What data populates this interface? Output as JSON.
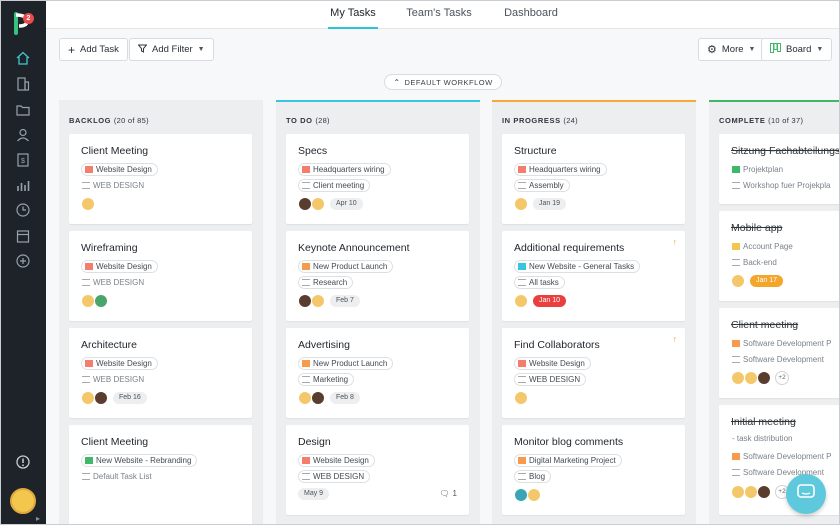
{
  "app": {
    "logo_badge": "2"
  },
  "sidebar": {
    "items": [
      {
        "icon": "home-icon"
      },
      {
        "icon": "building-icon"
      },
      {
        "icon": "folder-icon"
      },
      {
        "icon": "user-icon"
      },
      {
        "icon": "invoice-icon"
      },
      {
        "icon": "chart-icon"
      },
      {
        "icon": "clock-icon"
      },
      {
        "icon": "calendar-icon"
      },
      {
        "icon": "plus-circle-icon"
      }
    ],
    "help_icon": "info-icon"
  },
  "topnav": {
    "tabs": [
      "My Tasks",
      "Team's Tasks",
      "Dashboard"
    ],
    "active": "My Tasks"
  },
  "toolbar": {
    "add_task": "Add Task",
    "add_filter": "Add Filter",
    "more": "More",
    "board": "Board",
    "workflow": "DEFAULT WORKFLOW"
  },
  "colors": {
    "accent": "#2ac4d5",
    "todo": "#37c6e0",
    "in_progress": "#f6a936",
    "complete": "#3fb86a",
    "overdue": "#e9403d"
  },
  "columns": [
    {
      "title": "BACKLOG",
      "count": "(20 of 85)",
      "cards": [
        {
          "title": "Client Meeting",
          "tags": [
            "Website Design",
            "WEB DESIGN"
          ],
          "date": ""
        },
        {
          "title": "Wireframing",
          "tags": [
            "Website Design",
            "WEB DESIGN"
          ],
          "date": ""
        },
        {
          "title": "Architecture",
          "tags": [
            "Website Design",
            "WEB DESIGN"
          ],
          "date": "Feb 16"
        },
        {
          "title": "Client Meeting",
          "tags": [
            "New Website - Rebranding",
            "Default Task List"
          ],
          "date": ""
        }
      ]
    },
    {
      "title": "TO DO",
      "count": "(28)",
      "cards": [
        {
          "title": "Specs",
          "tags": [
            "Headquarters wiring",
            "Client meeting"
          ],
          "date": "Apr 10"
        },
        {
          "title": "Keynote Announcement",
          "tags": [
            "New Product Launch",
            "Research"
          ],
          "date": "Feb 7"
        },
        {
          "title": "Advertising",
          "tags": [
            "New Product Launch",
            "Marketing"
          ],
          "date": "Feb 8"
        },
        {
          "title": "Design",
          "tags": [
            "Website Design",
            "WEB DESIGN"
          ],
          "date": "May 9",
          "comments": "1"
        }
      ]
    },
    {
      "title": "IN PROGRESS",
      "count": "(24)",
      "cards": [
        {
          "title": "Structure",
          "tags": [
            "Headquarters wiring",
            "Assembly"
          ],
          "date": "Jan 19"
        },
        {
          "title": "Additional requirements",
          "tags": [
            "New Website - General Tasks",
            "All tasks"
          ],
          "date": "Jan 10"
        },
        {
          "title": "Find Collaborators",
          "tags": [
            "Website Design",
            "WEB DESIGN"
          ],
          "date": ""
        },
        {
          "title": "Monitor blog comments",
          "tags": [
            "Digital Marketing Project",
            "Blog"
          ],
          "date": ""
        }
      ]
    },
    {
      "title": "COMPLETE",
      "count": "(10 of 37)",
      "cards": [
        {
          "title": "Sitzung Fachabteilungsl",
          "tags": [
            "Projektplan",
            "Workshop fuer Projekpla"
          ],
          "date": ""
        },
        {
          "title": "Mobile app",
          "tags": [
            "Account Page",
            "Back-end"
          ],
          "date": "Jan 17"
        },
        {
          "title": "Client meeting",
          "tags": [
            "Software Development P",
            "Software Development"
          ],
          "more": "+2"
        },
        {
          "title": "Initial meeting",
          "subtitle": "- task distribution",
          "tags": [
            "Software Development P",
            "Software Development"
          ],
          "more": "+2"
        }
      ]
    }
  ]
}
